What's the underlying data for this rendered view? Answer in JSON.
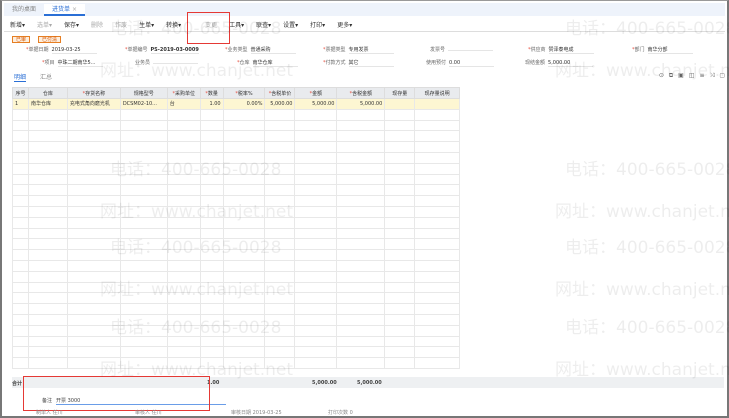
{
  "tabs": [
    "我的桌面",
    "进货单"
  ],
  "toolbar": [
    "新增▾",
    "选单▾",
    "保存▾",
    "删除",
    "作废",
    "生单▾",
    "转换▾",
    "变更",
    "工具▾",
    "联查▾",
    "设置▾",
    "打印▾",
    "更多▾"
  ],
  "badges": [
    "已审",
    "已付清"
  ],
  "fields": {
    "date": {
      "label": "单据日期",
      "value": "2019-03-25"
    },
    "code": {
      "label": "单据编号",
      "value": "PS-2019-03-0009"
    },
    "biz_type": {
      "label": "业务类型",
      "value": "普通采购"
    },
    "invoice_type": {
      "label": "票据类型",
      "value": "专用发票"
    },
    "invoice_no": {
      "label": "发票号",
      "value": ""
    },
    "supplier": {
      "label": "供应商",
      "value": "赞泽泰电成"
    },
    "dept": {
      "label": "部门",
      "value": "南华分部"
    },
    "project": {
      "label": "项目",
      "value": "中珠二期南华5..."
    },
    "clerk": {
      "label": "业务员",
      "value": ""
    },
    "warehouse": {
      "label": "仓库",
      "value": "南华仓库"
    },
    "pay_method": {
      "label": "付款方式",
      "value": "其它"
    },
    "prepay": {
      "label": "使用预付",
      "value": "0.00"
    },
    "paid": {
      "label": "现结金额",
      "value": "5,000.00"
    }
  },
  "subtabs": [
    "明细",
    "汇总"
  ],
  "table": {
    "headers": [
      "序号",
      "仓库",
      "存货名称",
      "规格型号",
      "采购单位",
      "数量",
      "税率%",
      "含税单价",
      "金额",
      "含税金额",
      "现存量",
      "现存量说明"
    ],
    "rows": [
      [
        "1",
        "南华仓库",
        "充电式角向磨光机",
        "DCSM02-10...",
        "台",
        "1.00",
        "0.00%",
        "5,000.00",
        "5,000.00",
        "5,000.00",
        "",
        ""
      ]
    ]
  },
  "totals": {
    "label": "合计",
    "qty": "1.00",
    "amount": "5,000.00",
    "tax_amount": "5,000.00"
  },
  "remark": {
    "label": "备注",
    "value": "开票 3000"
  },
  "footer": {
    "maker": "制单人 任川",
    "auditor": "审核人 任川",
    "audit_date": "审核日期 2019-03-25",
    "print_count": "打印次数 0"
  },
  "watermark": {
    "phone": "电话：400-665-0028",
    "site": "网址：www.chanjet.net"
  }
}
